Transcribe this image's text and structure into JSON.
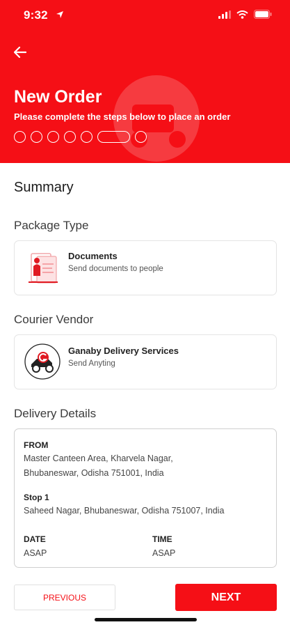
{
  "status_bar": {
    "time": "9:32",
    "icons": [
      "location-arrow-icon",
      "signal-icon",
      "wifi-icon",
      "battery-icon"
    ]
  },
  "header": {
    "back_icon": "back-arrow-icon",
    "title": "New Order",
    "subtitle": "Please complete the steps below to place an order",
    "steps_total": 7,
    "active_step": 6
  },
  "summary": {
    "title": "Summary"
  },
  "package": {
    "label": "Package Type",
    "name": "Documents",
    "description": "Send documents to people"
  },
  "courier": {
    "label": "Courier Vendor",
    "name": "Ganaby Delivery Services",
    "description": "Send Anyting"
  },
  "delivery": {
    "label": "Delivery Details",
    "from_label": "FROM",
    "from_line1": "Master Canteen Area, Kharvela Nagar,",
    "from_line2": "Bhubaneswar, Odisha 751001, India",
    "stop_label": "Stop 1",
    "stop_address": "Saheed Nagar, Bhubaneswar, Odisha 751007, India",
    "date_label": "DATE",
    "date_value": "ASAP",
    "time_label": "TIME",
    "time_value": "ASAP"
  },
  "footer": {
    "previous_label": "PREVIOUS",
    "next_label": "NEXT"
  },
  "colors": {
    "brand_red": "#f50f16"
  }
}
